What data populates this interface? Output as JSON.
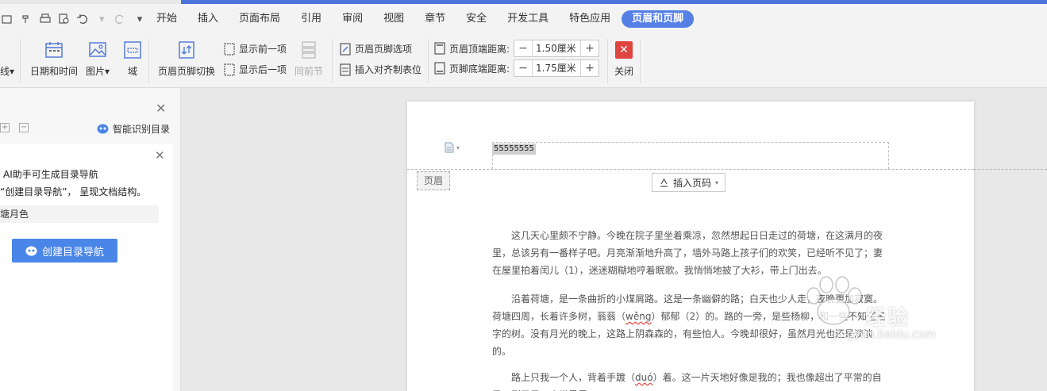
{
  "menubar": {
    "items": [
      "开始",
      "插入",
      "页面布局",
      "引用",
      "审阅",
      "视图",
      "章节",
      "安全",
      "开发工具",
      "特色应用",
      "页眉和页脚"
    ],
    "active_index": 10
  },
  "ribbon": {
    "line_label": "线",
    "date_time": "日期和时间",
    "picture": "图片",
    "field": "域",
    "switch": "页眉页脚切换",
    "show_prev": "显示前一项",
    "show_next": "显示后一项",
    "same_section": "同前节",
    "options": "页眉页脚选项",
    "insert_align_tab": "插入对齐制表位",
    "header_top_label": "页眉顶端距离:",
    "header_top_value": "1.50厘米",
    "footer_bottom_label": "页脚底端距离:",
    "footer_bottom_value": "1.75厘米",
    "close": "关闭"
  },
  "left_panel": {
    "smart_detect": "智能识别目录",
    "card_line1": "AI助手可生成目录导航",
    "card_line2": "“创建目录导航”， 呈现文档结构。",
    "card_field": "塘月色",
    "create_button": "创建目录导航"
  },
  "document": {
    "header_text": "55555555",
    "header_label": "页眉",
    "insert_page_number": "插入页码",
    "para1": "这几天心里颇不宁静。今晚在院子里坐着乘凉，忽然想起日日走过的荷塘，在这满月的夜里，总该另有一番样子吧。月亮渐渐地升高了，墙外马路上孩子们的欢笑，已经听不见了；妻在屋里拍着闰儿（1），迷迷糊糊地哼着眠歌。我悄悄地披了大衫，带上门出去。",
    "para2_a": "沿着荷塘，是一条曲折的小煤屑路。这是一条幽僻的路；白天也少人走，夜晚更加寂寞。荷塘四周，长着许多树，蓊蓊（",
    "para2_wavy": "wěng",
    "para2_b": "）郁郁（2）的。路的一旁，是些杨柳，和一些不知道名字的树。没有月光的晚上，这路上阴森森的，有些怕人。今晚却很好，虽然月光也还是淡淡的。",
    "para3_a": "路上只我一个人，背着手踱（",
    "para3_wavy": "duó",
    "para3_b": "）着。这一片天地好像是我的；我也像超出了平常的自己，到了另一个世界里。"
  },
  "watermark": {
    "brand": "经验",
    "url": "jingyan.baidu.com"
  },
  "colors": {
    "accent": "#4a74d9",
    "active_tab": "#5580e6",
    "primary_button": "#4a86e8",
    "close_red": "#e0443e"
  }
}
